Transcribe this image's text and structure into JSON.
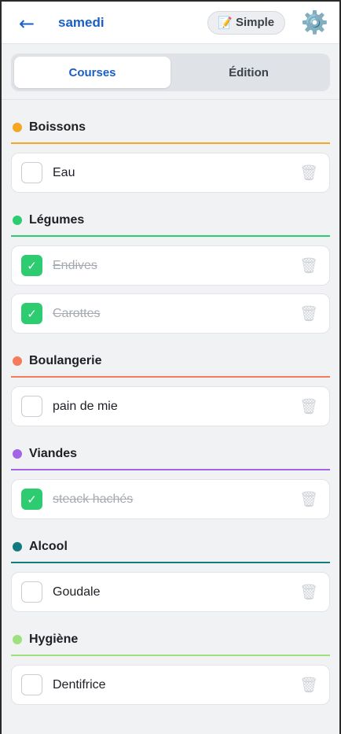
{
  "header": {
    "back_icon": "←",
    "title": "samedi",
    "mode_icon": "📝",
    "mode_label": "Simple",
    "settings_icon": "⚙️"
  },
  "tabs": [
    {
      "label": "Courses",
      "active": true
    },
    {
      "label": "Édition",
      "active": false
    }
  ],
  "check_glyph": "✓",
  "trash_icon": "🗑",
  "sections": [
    {
      "name": "Boissons",
      "color": "#f5a623",
      "items": [
        {
          "label": "Eau",
          "checked": false
        }
      ]
    },
    {
      "name": "Légumes",
      "color": "#2ecc71",
      "items": [
        {
          "label": "Endives",
          "checked": true
        },
        {
          "label": "Carottes",
          "checked": true
        }
      ]
    },
    {
      "name": "Boulangerie",
      "color": "#f47c5c",
      "items": [
        {
          "label": "pain de mie",
          "checked": false
        }
      ]
    },
    {
      "name": "Viandes",
      "color": "#a363e6",
      "items": [
        {
          "label": "steack hachés",
          "checked": true
        }
      ]
    },
    {
      "name": "Alcool",
      "color": "#127b80",
      "items": [
        {
          "label": "Goudale",
          "checked": false
        }
      ]
    },
    {
      "name": "Hygiène",
      "color": "#9fe07e",
      "items": [
        {
          "label": "Dentifrice",
          "checked": false
        }
      ]
    }
  ]
}
